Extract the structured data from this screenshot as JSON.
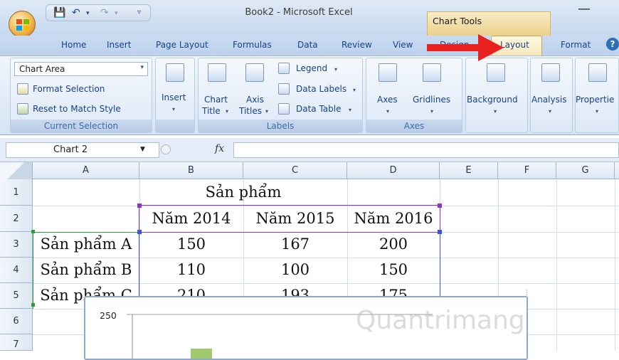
{
  "window": {
    "title": "Book2 - Microsoft Excel",
    "context_tab_group": "Chart Tools"
  },
  "ribbon": {
    "tabs": [
      "Home",
      "Insert",
      "Page Layout",
      "Formulas",
      "Data",
      "Review",
      "View",
      "Design",
      "Layout",
      "Format"
    ],
    "active_tab": "Layout",
    "groups": {
      "current_selection": {
        "label": "Current Selection",
        "combo_value": "Chart Area",
        "format_selection": "Format Selection",
        "reset_to_match_style": "Reset to Match Style"
      },
      "insert": {
        "label": "Insert"
      },
      "labels": {
        "label": "Labels",
        "chart_title": [
          "Chart",
          "Title"
        ],
        "axis_titles": [
          "Axis",
          "Titles"
        ],
        "legend": "Legend",
        "data_labels": "Data Labels",
        "data_table": "Data Table"
      },
      "axes": {
        "label": "Axes",
        "axes": "Axes",
        "gridlines": "Gridlines"
      },
      "background": "Background",
      "analysis": "Analysis",
      "properties": "Propertie"
    }
  },
  "formula_bar": {
    "name_box": "Chart 2",
    "fx": "fx",
    "formula": ""
  },
  "sheet": {
    "columns": [
      "A",
      "B",
      "C",
      "D",
      "E",
      "F",
      "G"
    ],
    "rows": [
      "1",
      "2",
      "3",
      "4",
      "5",
      "6",
      "7"
    ],
    "header_merged": "Sản phẩm",
    "year_headers": [
      "Năm 2014",
      "Năm 2015",
      "Năm 2016"
    ],
    "data_rows": [
      {
        "name": "Sản phẩm A",
        "values": [
          "150",
          "167",
          "200"
        ]
      },
      {
        "name": "Sản phẩm B",
        "values": [
          "110",
          "100",
          "150"
        ]
      },
      {
        "name": "Sản phẩm C",
        "values": [
          "210",
          "193",
          "175"
        ]
      }
    ]
  },
  "chart": {
    "y_top_tick": "250"
  },
  "watermark": "Quantrimang",
  "colors": {
    "arrow": "#e8201e",
    "chart_border": "#8faac6",
    "range_purple": "#8e35c0",
    "range_blue": "#3a55d6",
    "range_green": "#2f9e3b"
  }
}
